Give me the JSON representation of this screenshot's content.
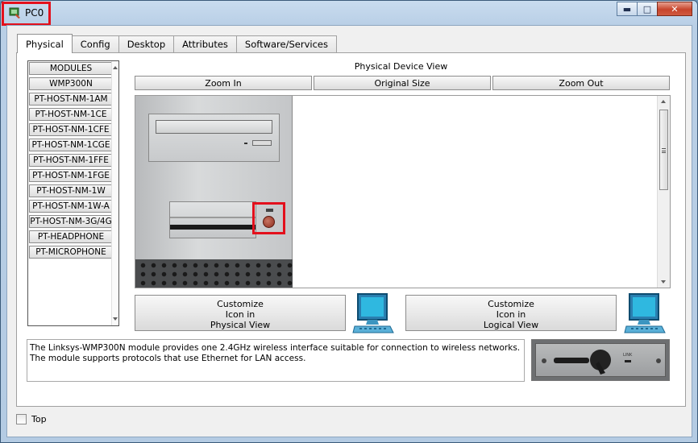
{
  "window": {
    "title": "PC0",
    "minimize_glyph": "▬",
    "maximize_glyph": "□",
    "close_glyph": "✕"
  },
  "tabs": [
    "Physical",
    "Config",
    "Desktop",
    "Attributes",
    "Software/Services"
  ],
  "active_tab": "Physical",
  "modules": [
    "MODULES",
    "WMP300N",
    "PT-HOST-NM-1AM",
    "PT-HOST-NM-1CE",
    "PT-HOST-NM-1CFE",
    "PT-HOST-NM-1CGE",
    "PT-HOST-NM-1FFE",
    "PT-HOST-NM-1FGE",
    "PT-HOST-NM-1W",
    "PT-HOST-NM-1W-A",
    "PT-HOST-NM-3G/4G",
    "PT-HEADPHONE",
    "PT-MICROPHONE"
  ],
  "physical_view": {
    "label": "Physical Device View",
    "zoom_in": "Zoom In",
    "original_size": "Original Size",
    "zoom_out": "Zoom Out"
  },
  "customize_physical": [
    "Customize",
    "Icon in",
    "Physical View"
  ],
  "customize_logical": [
    "Customize",
    "Icon in",
    "Logical View"
  ],
  "description": "The Linksys-WMP300N module provides one 2.4GHz wireless interface suitable for connection to wireless networks. The module supports protocols that use Ethernet for LAN access.",
  "module_image_label": "LINK",
  "top_checkbox_label": "Top",
  "top_checked": false,
  "colors": {
    "highlight": "#e3101c",
    "monitor_screen": "#1a9fd0"
  }
}
